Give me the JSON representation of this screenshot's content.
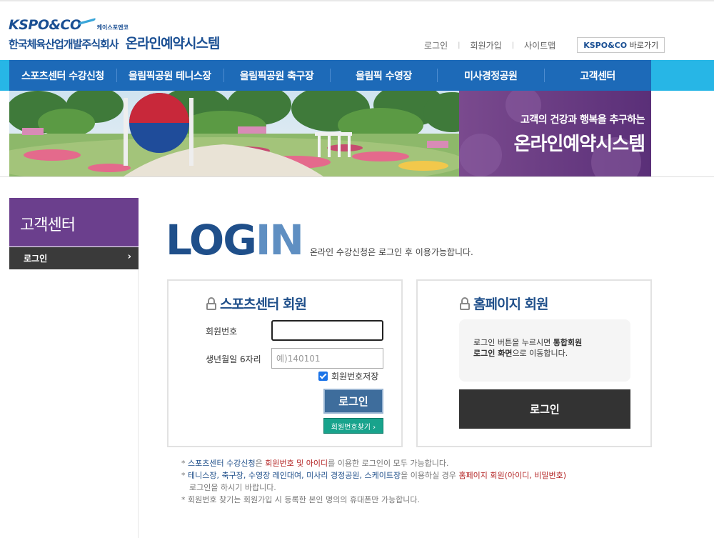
{
  "header": {
    "logo_brand": "KSPO&CO",
    "logo_kr_small": "케이스포앤코",
    "company": "한국체육산업개발주식회사",
    "system": "온라인예약시스템"
  },
  "util": {
    "login": "로그인",
    "join": "회원가입",
    "sitemap": "사이트맵",
    "goto_brand": "KSPO&CO",
    "goto_label": "바로가기"
  },
  "nav": [
    "스포츠센터 수강신청",
    "올림픽공원 테니스장",
    "올림픽공원 축구장",
    "올림픽 수영장",
    "미사경정공원",
    "고객센터"
  ],
  "banner": {
    "sub": "고객의 건강과 행복을 추구하는",
    "title": "온라인예약시스템"
  },
  "sidebar": {
    "title": "고객센터",
    "item": "로그인"
  },
  "main": {
    "heading_part1": "LOG",
    "heading_part2": "IN",
    "desc": "온라인 수강신청은 로그인 후 이용가능합니다."
  },
  "sports_box": {
    "title": "스포츠센터 회원",
    "member_no_label": "회원번호",
    "member_no_value": "",
    "birth_label": "생년월일 6자리",
    "birth_placeholder": "예)140101",
    "save_label": "회원번호저장",
    "login_button": "로그인",
    "find_button": "회원번호찾기 ›"
  },
  "home_box": {
    "title": "홈페이지 회원",
    "notice_1": "로그인 버튼을 누르시면 ",
    "notice_2": "통합회원",
    "notice_3": "로그인 화면",
    "notice_4": "으로 이동합니다.",
    "login_button": "로그인"
  },
  "notes": {
    "n1_a": "* ",
    "n1_b": "스포츠센터 수강신청",
    "n1_c": "은 ",
    "n1_d": "회원번호 및 아이디",
    "n1_e": "를 이용한 로그인이 모두 가능합니다.",
    "n2_a": "* ",
    "n2_b": "테니스장, 축구장, 수영장 레인대여, 미사리 경정공원, 스케이트장",
    "n2_c": "을 이용하실 경우 ",
    "n2_d": "홈페이지 회원(아이디, 비밀번호)",
    "n2_e": "로그인을 하시기 바랍니다.",
    "n3": "* 회원번호 찾기는 회원가입 시 등록한 본인 명의의 휴대폰만 가능합니다."
  }
}
